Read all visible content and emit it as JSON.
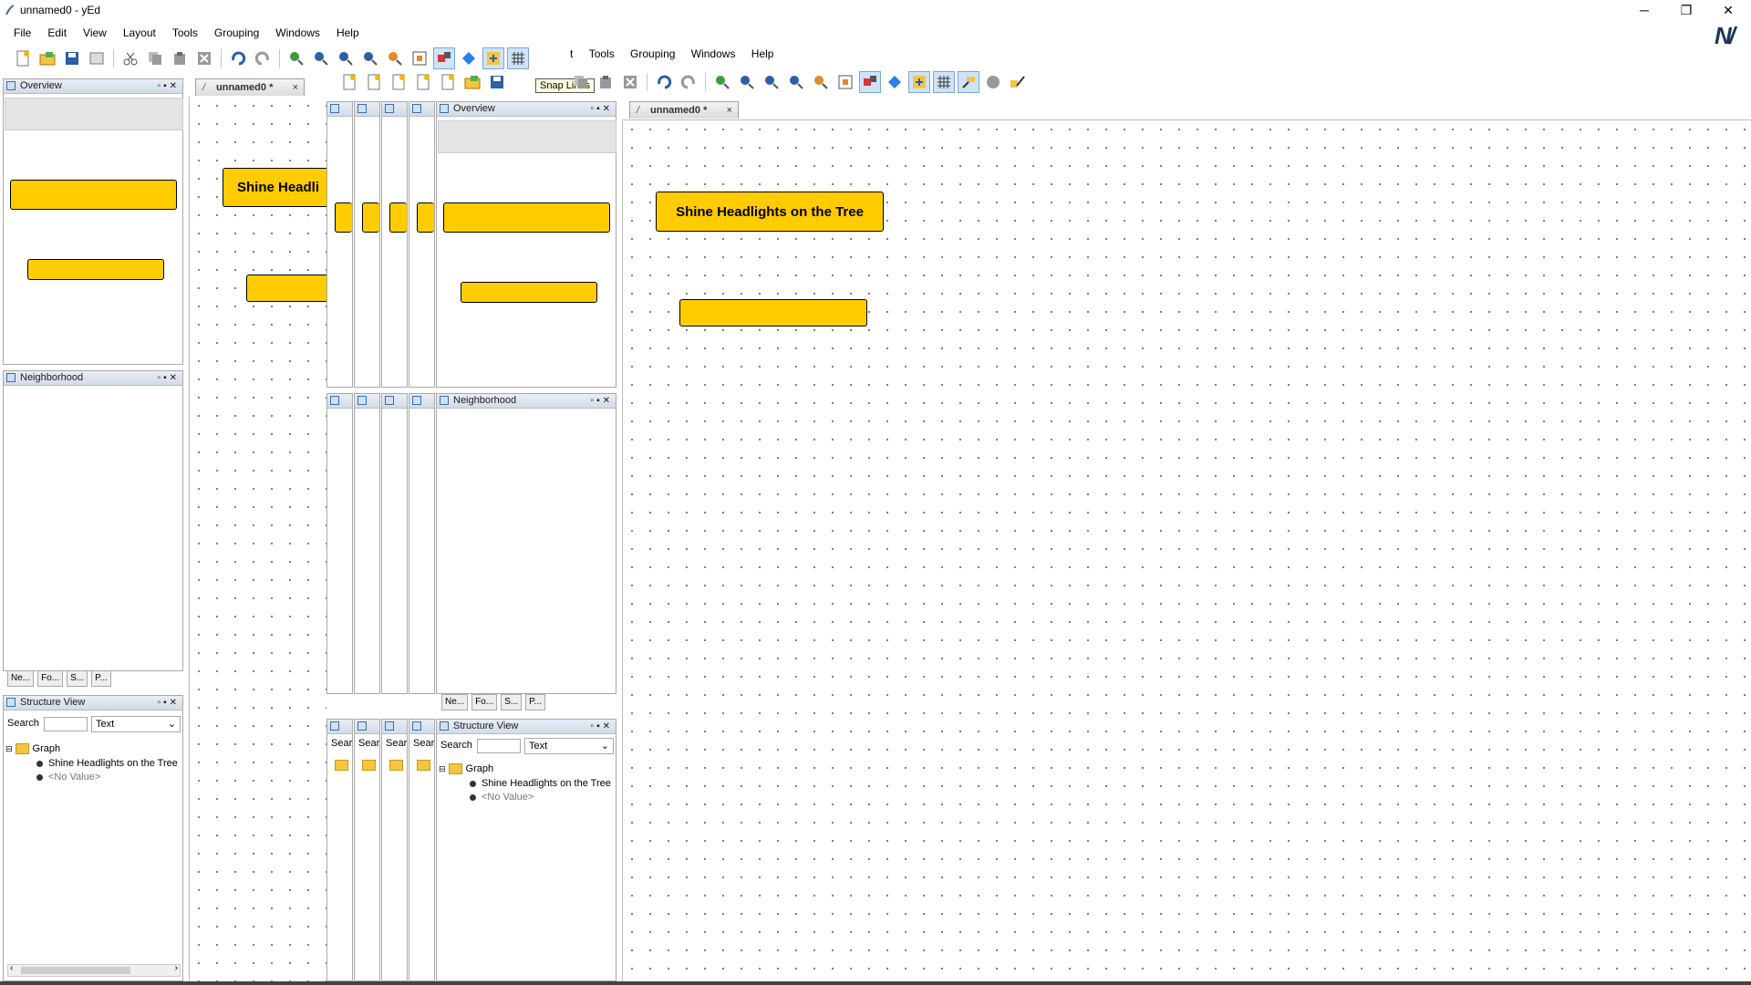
{
  "window": {
    "title": "unnamed0 - yEd",
    "minimize": "─",
    "restore": "❐",
    "close": "✕",
    "logo": "Ν/"
  },
  "menu": [
    "File",
    "Edit",
    "View",
    "Layout",
    "Tools",
    "Grouping",
    "Windows",
    "Help"
  ],
  "inner_menu": [
    "t",
    "Tools",
    "Grouping",
    "Windows",
    "Help"
  ],
  "tooltip": "Snap Lines",
  "document_tab": "unnamed0 *",
  "tab_close": "×",
  "overview_title": "Overview",
  "neighborhood_title": "Neighborhood",
  "structure_title": "Structure View",
  "bottom_tabs": [
    "Ne...",
    "Fo...",
    "S...",
    "P..."
  ],
  "search_label": "Search",
  "search_short": "Sear",
  "search_value": "",
  "search_mode": "Text",
  "tree": {
    "root": "Graph",
    "items": [
      "Shine Headlights on the Tree",
      "<No Value>"
    ]
  },
  "nodes": {
    "node1_label": "Shine Headlights on the Tree",
    "node1_clipped": "Shine Headli",
    "node2_label": ""
  },
  "colors": {
    "node_fill": "#ffcc00",
    "accent": "#3b6ea5"
  }
}
